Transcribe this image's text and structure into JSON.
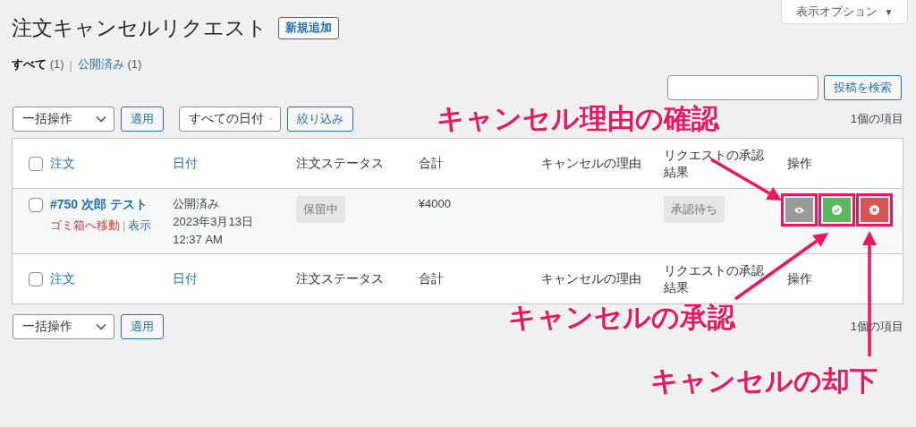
{
  "screen_options": {
    "label": "表示オプション",
    "caret": "▼"
  },
  "page_title": "注文キャンセルリクエスト",
  "add_new": "新規追加",
  "views": [
    {
      "label": "すべて",
      "count": "(1)",
      "selected": true
    },
    {
      "separator": "|",
      "label": "公開済み",
      "count": "(1)",
      "selected": false
    }
  ],
  "search": {
    "button": "投稿を検索"
  },
  "top_toolbar": {
    "bulk_action": "一括操作",
    "apply": "適用",
    "date_filter": "すべての日付",
    "filter": "絞り込み",
    "item_count": "1個の項目"
  },
  "table": {
    "columns": [
      {
        "label": "注文",
        "sortable": true
      },
      {
        "label": "日付",
        "sortable": true
      },
      {
        "label": "注文ステータス",
        "sortable": false
      },
      {
        "label": "合計",
        "sortable": false
      },
      {
        "label": "キャンセルの理由",
        "sortable": false
      },
      {
        "label": "リクエストの承認結果",
        "sortable": false
      },
      {
        "label": "操作",
        "sortable": false
      }
    ],
    "footer_columns": [
      {
        "label": "注文",
        "sortable": true
      },
      {
        "label": "日付",
        "sortable": true
      },
      {
        "label": "注文ステータス",
        "sortable": false
      },
      {
        "label": "合計",
        "sortable": false
      },
      {
        "label": "キャンセルの理由",
        "sortable": false
      },
      {
        "label": "リクエストの承認結果",
        "sortable": false
      },
      {
        "label": "操作",
        "sortable": false
      }
    ],
    "header_checked": false,
    "footer_checked": false,
    "rows": [
      {
        "checked": false,
        "title": "#750 次郎 テスト",
        "row_actions": [
          {
            "label": "ゴミ箱へ移動",
            "kind": "trash"
          },
          {
            "separator": "|",
            "label": "表示",
            "kind": "view"
          }
        ],
        "date_lines": [
          "公開済み",
          "2023年3月13日",
          "12:37 AM"
        ],
        "status": "保留中",
        "total": "¥4000",
        "approval": "承認待ち",
        "actions": [
          {
            "kind": "view",
            "highlighted": true
          },
          {
            "kind": "approve",
            "highlighted": true
          },
          {
            "kind": "reject",
            "highlighted": true
          }
        ]
      }
    ]
  },
  "bottom_toolbar": {
    "bulk_action": "一括操作",
    "apply": "適用",
    "item_count": "1個の項目"
  },
  "annotations": [
    {
      "text": "キャンセル理由の確認"
    },
    {
      "text": "キャンセルの承認"
    },
    {
      "text": "キャンセルの却下"
    }
  ]
}
